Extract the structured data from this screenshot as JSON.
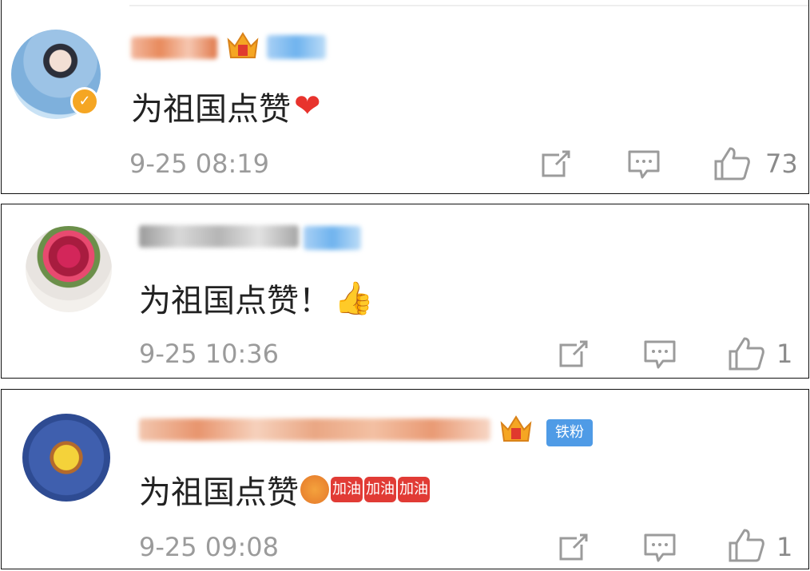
{
  "comments": [
    {
      "text": "为祖国点赞",
      "emoji": "heart-emoji",
      "time": "9-25 08:19",
      "likes": "73",
      "verified": true
    },
    {
      "text": "为祖国点赞！",
      "emoji": "thumbs-up-emoji",
      "time": "9-25 10:36",
      "likes": "1"
    },
    {
      "text": "为祖国点赞",
      "emoji": "fight-sticker-emoji",
      "fan_badge": "铁粉",
      "sticker_label": "加油",
      "time": "9-25 09:08",
      "likes": "1"
    }
  ],
  "icons": {
    "share": "share-icon",
    "reply": "comment-icon",
    "like": "thumbs-up-icon"
  },
  "colors": {
    "text": "#222222",
    "meta": "#9b9b9b",
    "fan_badge": "#4f9be6",
    "verified_badge": "#f5a623",
    "heart": "#e8332d"
  }
}
